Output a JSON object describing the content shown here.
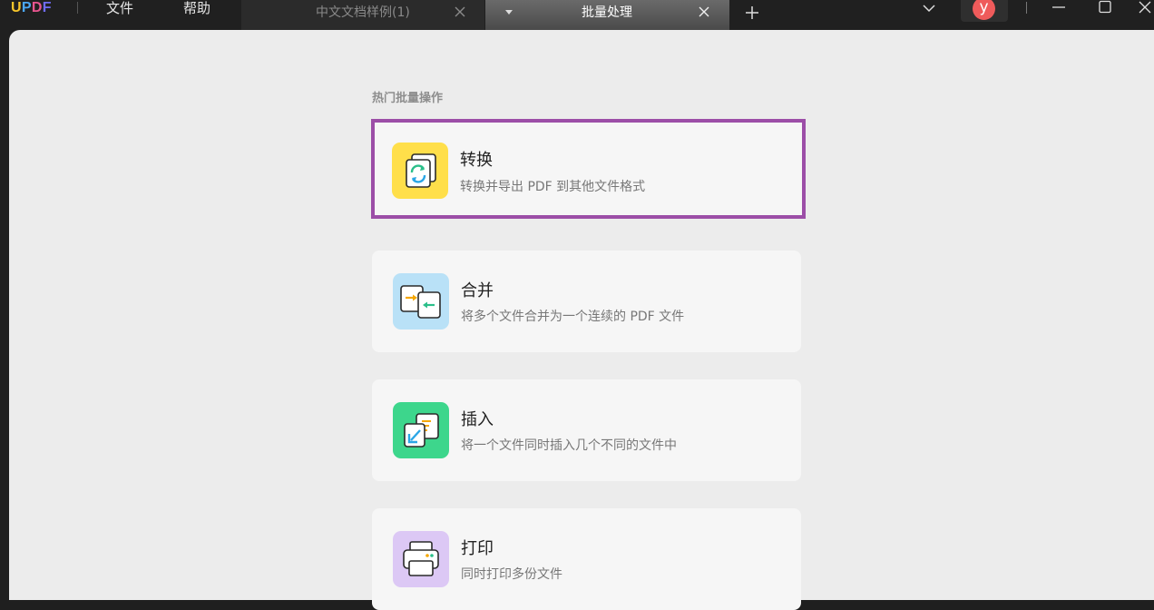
{
  "app": {
    "logo": "UPDF",
    "menu": [
      "文件",
      "帮助"
    ]
  },
  "tabs": [
    {
      "label": "中文文档样例(1)",
      "active": false
    },
    {
      "label": "批量处理",
      "active": true
    }
  ],
  "user": {
    "avatar_letter": "y"
  },
  "colors": {
    "selected_border": "#9c4ea7",
    "convert_bg": "#ffdf4a",
    "merge_bg": "#b9e1f7",
    "insert_bg": "#3dd68c",
    "print_bg": "#dcc8f5",
    "avatar": "#ef5b5b"
  },
  "section": {
    "title": "热门批量操作"
  },
  "operations": [
    {
      "title": "转换",
      "desc": "转换并导出 PDF 到其他文件格式",
      "icon": "convert-icon",
      "selected": true
    },
    {
      "title": "合并",
      "desc": "将多个文件合并为一个连续的 PDF 文件",
      "icon": "merge-icon",
      "selected": false
    },
    {
      "title": "插入",
      "desc": "将一个文件同时插入几个不同的文件中",
      "icon": "insert-icon",
      "selected": false
    },
    {
      "title": "打印",
      "desc": "同时打印多份文件",
      "icon": "print-icon",
      "selected": false
    }
  ]
}
